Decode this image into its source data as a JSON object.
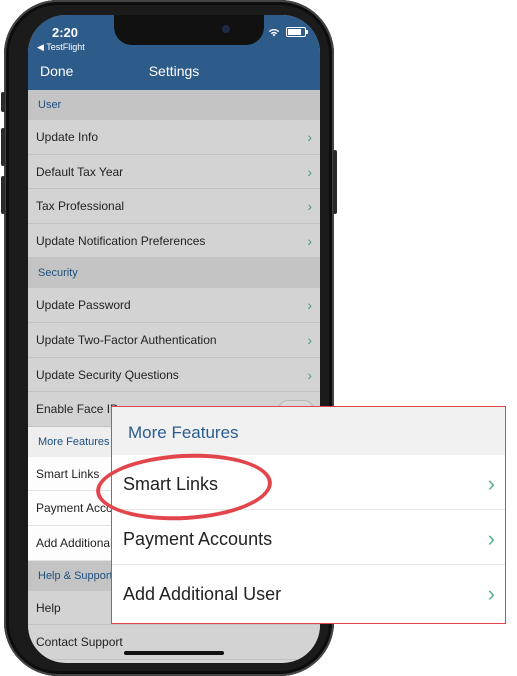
{
  "status_bar": {
    "time": "2:20",
    "back_app": "◀ TestFlight"
  },
  "navbar": {
    "done_label": "Done",
    "title": "Settings"
  },
  "sections": {
    "user": {
      "header": "User",
      "items": [
        {
          "label": "Update Info",
          "chevron": "›"
        },
        {
          "label": "Default Tax Year",
          "chevron": "›"
        },
        {
          "label": "Tax Professional",
          "chevron": "›"
        },
        {
          "label": "Update Notification Preferences",
          "chevron": "›"
        }
      ]
    },
    "security": {
      "header": "Security",
      "items": [
        {
          "label": "Update Password",
          "chevron": "›"
        },
        {
          "label": "Update Two-Factor Authentication",
          "chevron": "›"
        },
        {
          "label": "Update Security Questions",
          "chevron": "›"
        },
        {
          "label": "Enable Face ID"
        }
      ]
    },
    "more_features": {
      "header": "More Features",
      "items": [
        {
          "label": "Smart Links"
        },
        {
          "label": "Payment Accounts"
        },
        {
          "label": "Add Additional User"
        }
      ]
    },
    "help_support": {
      "header": "Help & Support",
      "items": [
        {
          "label": "Help"
        },
        {
          "label": "Contact Support"
        }
      ]
    }
  },
  "callout": {
    "header": "More Features",
    "items": [
      {
        "label": "Smart Links",
        "chevron": "›"
      },
      {
        "label": "Payment Accounts",
        "chevron": "›"
      },
      {
        "label": "Add Additional User",
        "chevron": "›"
      }
    ]
  },
  "colors": {
    "navbar": "#2d5b8a",
    "chevron": "#4a9a78",
    "highlight_border": "#e0454b"
  }
}
